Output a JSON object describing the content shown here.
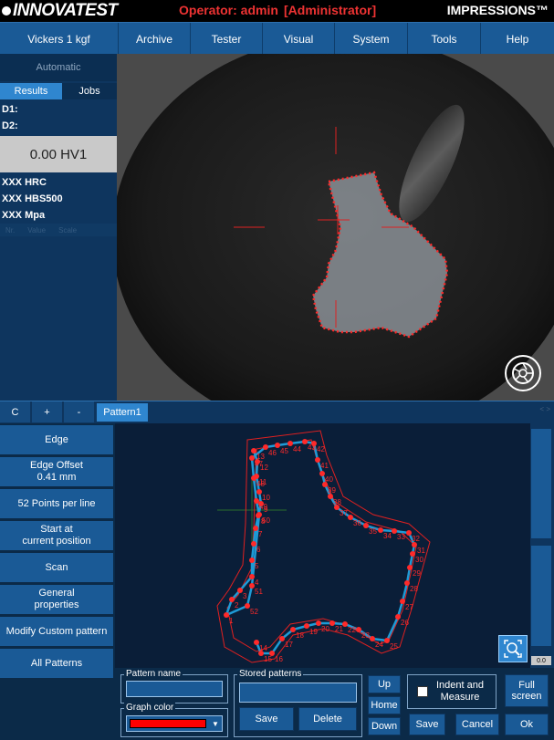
{
  "header": {
    "logo": "INNOVATEST",
    "operator": "Operator: admin",
    "role": "[Administrator]",
    "product": "IMPRESSIONS™"
  },
  "menu": [
    "Vickers 1 kgf",
    "Archive",
    "Tester",
    "Visual",
    "System",
    "Tools",
    "Help"
  ],
  "left": {
    "mode": "Automatic",
    "tabs": {
      "results": "Results",
      "jobs": "Jobs"
    },
    "d1": "D1:",
    "d2": "D2:",
    "hardness": "0.00 HV1",
    "conversions": [
      "XXX HRC",
      "XXX HBS500",
      "XXX Mpa"
    ],
    "columns": [
      "Nr.",
      "Value",
      "Scale"
    ]
  },
  "toolbar": {
    "c": "C",
    "plus": "+",
    "minus": "-",
    "pattern_tab": "Pattern1",
    "scroll_indicator": "< >"
  },
  "side_buttons": [
    {
      "name": "edge-button",
      "label": "Edge"
    },
    {
      "name": "edge-offset-button",
      "label": "Edge Offset",
      "sub": "0.41 mm"
    },
    {
      "name": "points-per-line-button",
      "label": "52 Points per line"
    },
    {
      "name": "start-position-button",
      "label": "Start at",
      "sub": "current position"
    },
    {
      "name": "scan-button",
      "label": "Scan"
    },
    {
      "name": "general-properties-button",
      "label": "General",
      "sub": "properties"
    },
    {
      "name": "modify-custom-pattern-button",
      "label": "Modify Custom pattern"
    },
    {
      "name": "all-patterns-button",
      "label": "All Patterns"
    }
  ],
  "zoom_value": "0.0",
  "bottom": {
    "pattern_name_legend": "Pattern name",
    "pattern_name_value": "",
    "graph_color_legend": "Graph color",
    "graph_color": "#ff0000",
    "stored_patterns_legend": "Stored patterns",
    "save": "Save",
    "delete": "Delete",
    "up": "Up",
    "home": "Home",
    "down": "Down",
    "indent_measure": "Indent and Measure",
    "save2": "Save",
    "cancel": "Cancel",
    "full_screen": "Full screen",
    "ok": "Ok"
  },
  "pattern_points": [
    {
      "label": "1"
    },
    {
      "label": "2"
    },
    {
      "label": "3"
    },
    {
      "label": "4"
    },
    {
      "label": "5"
    },
    {
      "label": "6"
    },
    {
      "label": "7"
    },
    {
      "label": "8"
    },
    {
      "label": "9"
    },
    {
      "label": "10"
    },
    {
      "label": "11"
    },
    {
      "label": "12"
    },
    {
      "label": "13"
    },
    {
      "label": "14"
    },
    {
      "label": "15"
    },
    {
      "label": "16"
    },
    {
      "label": "17"
    },
    {
      "label": "18"
    },
    {
      "label": "19"
    },
    {
      "label": "20"
    },
    {
      "label": "21"
    },
    {
      "label": "22"
    },
    {
      "label": "23"
    },
    {
      "label": "24"
    },
    {
      "label": "25"
    },
    {
      "label": "26"
    },
    {
      "label": "27"
    },
    {
      "label": "28"
    },
    {
      "label": "29"
    },
    {
      "label": "30"
    },
    {
      "label": "31"
    },
    {
      "label": "32"
    },
    {
      "label": "33"
    },
    {
      "label": "34"
    },
    {
      "label": "35"
    },
    {
      "label": "36"
    },
    {
      "label": "37"
    },
    {
      "label": "38"
    },
    {
      "label": "39"
    },
    {
      "label": "40"
    },
    {
      "label": "41"
    },
    {
      "label": "42"
    },
    {
      "label": "43"
    },
    {
      "label": "44"
    },
    {
      "label": "45"
    },
    {
      "label": "46"
    },
    {
      "label": "47"
    },
    {
      "label": "48"
    },
    {
      "label": "49"
    },
    {
      "label": "50"
    },
    {
      "label": "51"
    },
    {
      "label": "52"
    }
  ],
  "colors": {
    "accent": "#2f86cf",
    "menu": "#1a5a96",
    "marker": "#ff2a2a",
    "path": "#1e9bd6"
  }
}
